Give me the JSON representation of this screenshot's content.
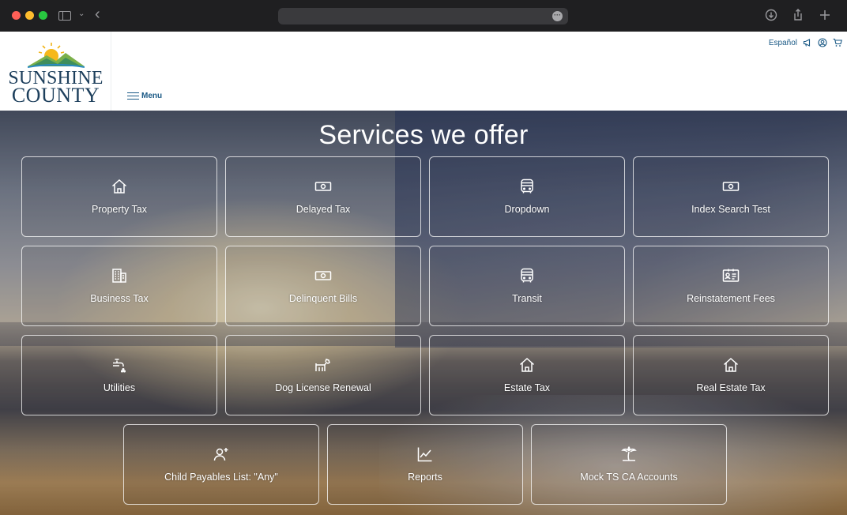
{
  "header": {
    "logo": {
      "line1": "SUNSHINE",
      "line2": "COUNTY"
    },
    "menu_label": "Menu",
    "language_link": "Español"
  },
  "hero": {
    "title": "Services we offer"
  },
  "services": [
    {
      "label": "Property Tax",
      "icon": "house-icon"
    },
    {
      "label": "Delayed Tax",
      "icon": "cash-icon"
    },
    {
      "label": "Dropdown",
      "icon": "bus-icon"
    },
    {
      "label": "Index Search Test",
      "icon": "cash-icon"
    },
    {
      "label": "Business Tax",
      "icon": "building-icon"
    },
    {
      "label": "Delinquent Bills",
      "icon": "cash-icon"
    },
    {
      "label": "Transit",
      "icon": "bus-icon"
    },
    {
      "label": "Reinstatement Fees",
      "icon": "id-card-icon"
    },
    {
      "label": "Utilities",
      "icon": "faucet-icon"
    },
    {
      "label": "Dog License Renewal",
      "icon": "dog-icon"
    },
    {
      "label": "Estate Tax",
      "icon": "house-icon"
    },
    {
      "label": "Real Estate Tax",
      "icon": "house-icon"
    },
    {
      "label": "Child Payables List: \"Any\"",
      "icon": "add-user-icon"
    },
    {
      "label": "Reports",
      "icon": "chart-line-icon"
    },
    {
      "label": "Mock TS CA Accounts",
      "icon": "palm-tree-icon"
    }
  ]
}
